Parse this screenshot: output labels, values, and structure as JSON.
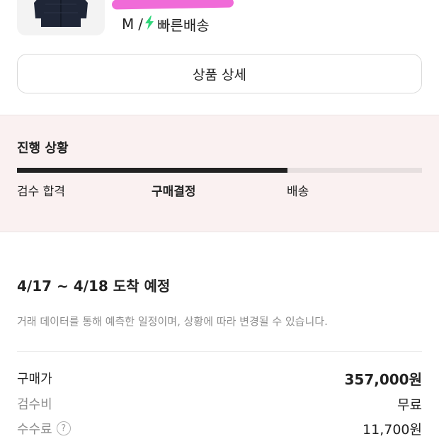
{
  "product": {
    "option_size": "M",
    "option_separator": "/",
    "shipping_label": "빠른배송",
    "shipping_icon": "lightning-bolt-icon",
    "accent_color": "#2fd67a"
  },
  "detail_button": {
    "label": "상품 상세"
  },
  "progress": {
    "title": "진행 상황",
    "percent": 66.7,
    "steps": [
      {
        "label": "검수 합격"
      },
      {
        "label": "구매결정",
        "current": true
      },
      {
        "label": "배송"
      }
    ]
  },
  "delivery": {
    "eta": "4/17 ~ 4/18 도착 예정",
    "note": "거래 데이터를 통해 예측한 일정이며, 상황에 따라 변경될 수 있습니다."
  },
  "summary": {
    "purchase_price_label": "구매가",
    "purchase_price_value": "357,000원",
    "inspection_fee_label": "검수비",
    "inspection_fee_value": "무료",
    "commission_label": "수수료",
    "commission_help_icon": "question-circle-icon",
    "commission_value": "11,700원"
  }
}
